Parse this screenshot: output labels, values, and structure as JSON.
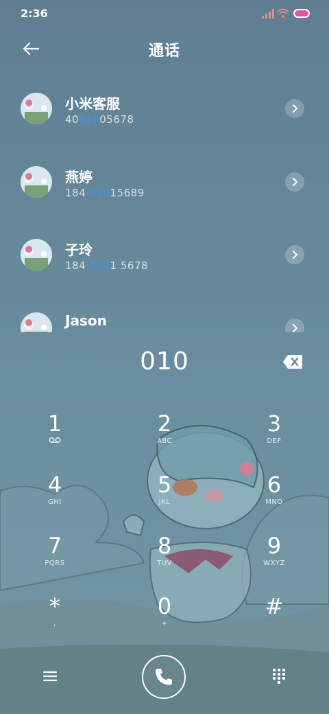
{
  "status_bar": {
    "time": "2:36"
  },
  "header": {
    "title": "通话"
  },
  "contacts": [
    {
      "name": "小米客服",
      "number_pre": "40",
      "number_match": "010",
      "number_post": "05678"
    },
    {
      "name": "燕婷",
      "number_pre": "184 ",
      "number_match": "010",
      "number_post": "15689"
    },
    {
      "name": "子玲",
      "number_pre": "184 ",
      "number_match": "010",
      "number_post": "1 5678"
    },
    {
      "name": "Jason",
      "number_pre": "",
      "number_match": "",
      "number_post": ""
    }
  ],
  "dialer": {
    "input": "010"
  },
  "keypad": [
    {
      "digit": "1",
      "letters": ""
    },
    {
      "digit": "2",
      "letters": "ABC"
    },
    {
      "digit": "3",
      "letters": "DEF"
    },
    {
      "digit": "4",
      "letters": "GHI"
    },
    {
      "digit": "5",
      "letters": "JKL"
    },
    {
      "digit": "6",
      "letters": "MNO"
    },
    {
      "digit": "7",
      "letters": "PQRS"
    },
    {
      "digit": "8",
      "letters": "TUV"
    },
    {
      "digit": "9",
      "letters": "WXYZ"
    },
    {
      "digit": "*",
      "letters": ","
    },
    {
      "digit": "0",
      "letters": "+"
    },
    {
      "digit": "#",
      "letters": ""
    }
  ],
  "icons": {
    "back": "arrow-left-icon",
    "detail": "chevron-right-icon",
    "backspace": "backspace-icon",
    "voicemail": "voicemail-icon",
    "menu": "menu-icon",
    "call": "phone-icon",
    "keypad": "dialpad-icon"
  },
  "colors": {
    "highlight": "#3b95e8",
    "accent_battery": "#e05a9a"
  }
}
